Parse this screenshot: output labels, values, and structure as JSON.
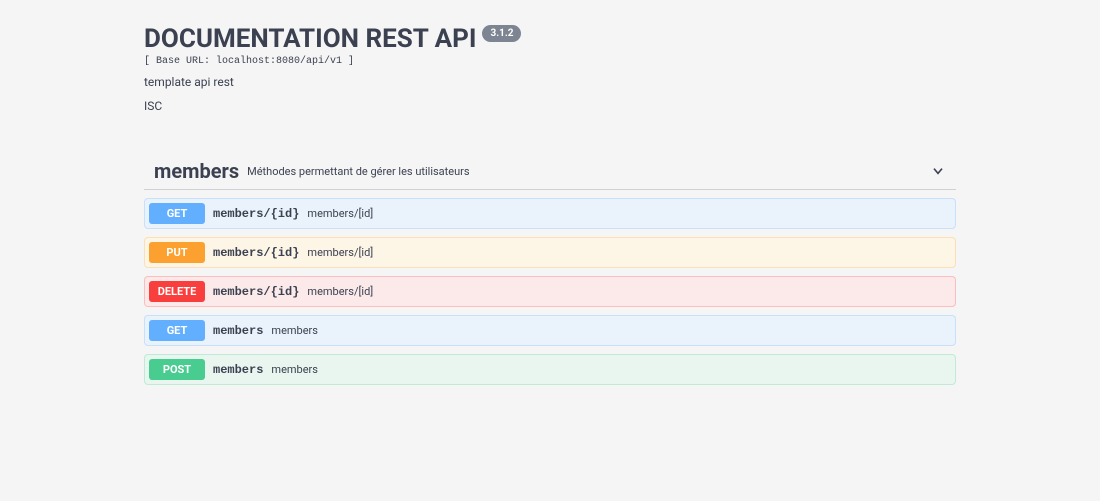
{
  "header": {
    "title": "DOCUMENTATION REST API",
    "version": "3.1.2",
    "baseurl": "[ Base URL: localhost:8080/api/v1 ]",
    "description": "template api rest",
    "license": "ISC"
  },
  "tag": {
    "name": "members",
    "description": "Méthodes permettant de gérer les utilisateurs"
  },
  "operations": [
    {
      "method": "GET",
      "path": "members/{id}",
      "summary": "members/[id]"
    },
    {
      "method": "PUT",
      "path": "members/{id}",
      "summary": "members/[id]"
    },
    {
      "method": "DELETE",
      "path": "members/{id}",
      "summary": "members/[id]"
    },
    {
      "method": "GET",
      "path": "members",
      "summary": "members"
    },
    {
      "method": "POST",
      "path": "members",
      "summary": "members"
    }
  ]
}
